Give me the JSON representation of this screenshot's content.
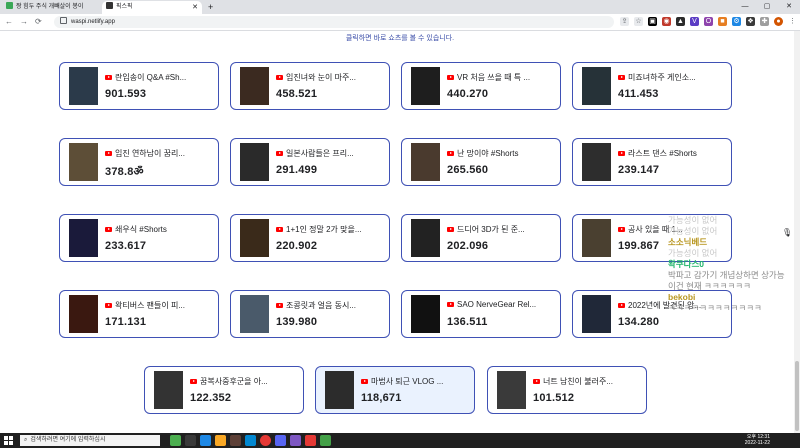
{
  "browser": {
    "tabs": [
      {
        "title": "짱 힘두 주식 개빼살이 봉이",
        "active": false
      },
      {
        "title": "픽스픽",
        "active": true
      }
    ],
    "url": "waspi.netlify.app",
    "back": "←",
    "forward": "→",
    "reload": "⟳",
    "new_tab": "+",
    "minimize": "—",
    "maximize": "▢",
    "close": "✕"
  },
  "page": {
    "top_note": "클릭하면 바로 쇼츠를 볼 수 있습니다.",
    "cards": [
      {
        "title": "란입송이 Q&A #Sh...",
        "views": "901.593"
      },
      {
        "title": "임진녀와 눈이 마주...",
        "views": "458.521"
      },
      {
        "title": "VR 처음 쓰을 때 특 ...",
        "views": "440.270"
      },
      {
        "title": "미죠녀하주 게인소...",
        "views": "411.453"
      },
      {
        "title": "임진 연하남이 꿈리...",
        "views": "378.8ॐ"
      },
      {
        "title": "일본사람들은 프리...",
        "views": "291.499"
      },
      {
        "title": "난 망이야 #Shorts",
        "views": "265.560"
      },
      {
        "title": "라스트 댄스 #Shorts",
        "views": "239.147"
      },
      {
        "title": "쇄우식 #Shorts",
        "views": "233.617"
      },
      {
        "title": "1+1인 정말 2가 맞을...",
        "views": "220.902"
      },
      {
        "title": "드디어 3D가 된 준...",
        "views": "202.096"
      },
      {
        "title": "공사 있을 때 1...",
        "views": "199.867"
      },
      {
        "title": "왁티버스 팬들이 피...",
        "views": "171.131"
      },
      {
        "title": "조콩릿과 얼음 동시...",
        "views": "139.980"
      },
      {
        "title": "SAO NerveGear Rel...",
        "views": "136.511"
      },
      {
        "title": "2022년에 발견된 앙...",
        "views": "134.280"
      },
      {
        "title": "꿈복사중후군을 아...",
        "views": "122.352"
      },
      {
        "title": "마법사 퇴근 VLOG ...",
        "views": "118,671"
      },
      {
        "title": "너트 남친이 불러주...",
        "views": "101.512"
      }
    ]
  },
  "chat": {
    "lines": [
      {
        "text": "가능성이 없어",
        "style": "faint"
      },
      {
        "text": "가능성이 없어",
        "style": "faint"
      },
      {
        "text": "소소닉베드",
        "style": "name2"
      },
      {
        "text": "가능성이 없어",
        "style": "faint"
      },
      {
        "text": "왁쿠다스0",
        "style": "name1"
      },
      {
        "text": "박파고 감가기 개념상하면 상가능",
        "style": "msg"
      },
      {
        "text": "이건 현재 ㅋㅋㅋㅋㅋㅋ",
        "style": "msg"
      },
      {
        "text": "bekobi",
        "style": "name2"
      },
      {
        "text": "ㅋㅋㅋㅋㅋㅋㅋㅋㅋㅋㅋㅋ",
        "style": "msg"
      }
    ]
  },
  "taskbar": {
    "search_placeholder": "검색하려면 여기에 입력하십시",
    "time": "오후 12:31",
    "date": "2022-11-22"
  },
  "colors": {
    "card_border": "#3f51b5",
    "selected_bg": "#eaf2fe",
    "youtube_red": "#ff0000",
    "chat_name_green": "#1fb46a",
    "chat_name_gold": "#b8961f"
  }
}
